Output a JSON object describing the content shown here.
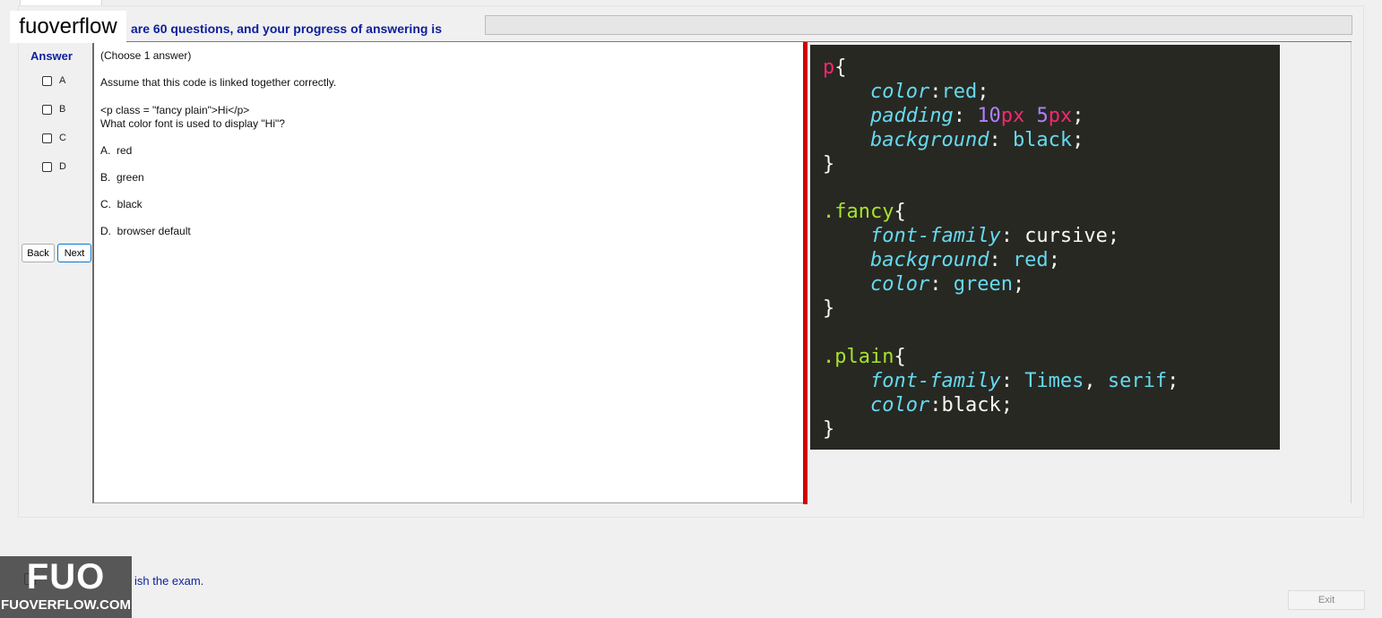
{
  "header": {
    "progress_text": "are 60 questions, and your progress of answering is",
    "progress_percent": 0
  },
  "watermark": {
    "top_text": "fuoverflow",
    "logo_big": "FUO",
    "logo_small": "FUOVERFLOW.COM"
  },
  "answer_panel": {
    "title": "Answer",
    "options": [
      "A",
      "B",
      "C",
      "D"
    ],
    "back_label": "Back",
    "next_label": "Next"
  },
  "question": {
    "lines": [
      "(Choose 1 answer)",
      "Assume that this code is linked together correctly.",
      "<p class = \"fancy plain\">Hi</p>",
      "What color font is used to display \"Hi\"?",
      "A.  red",
      "B.  green",
      "C.  black",
      "D.  browser default"
    ]
  },
  "code": {
    "p_selector": "p",
    "p_color_prop": "color",
    "p_color_val": "red",
    "p_padding_prop": "padding",
    "p_padding_num1": "10",
    "p_padding_unit1": "px",
    "p_padding_num2": "5",
    "p_padding_unit2": "px",
    "p_bg_prop": "background",
    "p_bg_val": "black",
    "fancy_selector": ".fancy",
    "fancy_ff_prop": "font-family",
    "fancy_ff_val": "cursive",
    "fancy_bg_prop": "background",
    "fancy_bg_val": "red",
    "fancy_color_prop": "color",
    "fancy_color_val": "green",
    "plain_selector": ".plain",
    "plain_ff_prop": "font-family",
    "plain_ff_val1": "Times",
    "plain_ff_val2": "serif",
    "plain_color_prop": "color",
    "plain_color_val": "black"
  },
  "footer": {
    "finish_text": "ish the exam.",
    "exit_label": "Exit"
  },
  "colors": {
    "accent_blue": "#0b1f9c",
    "divider_red": "#d40000",
    "code_background": "#272822"
  },
  "icons": {
    "checkbox": "checkbox-icon"
  }
}
